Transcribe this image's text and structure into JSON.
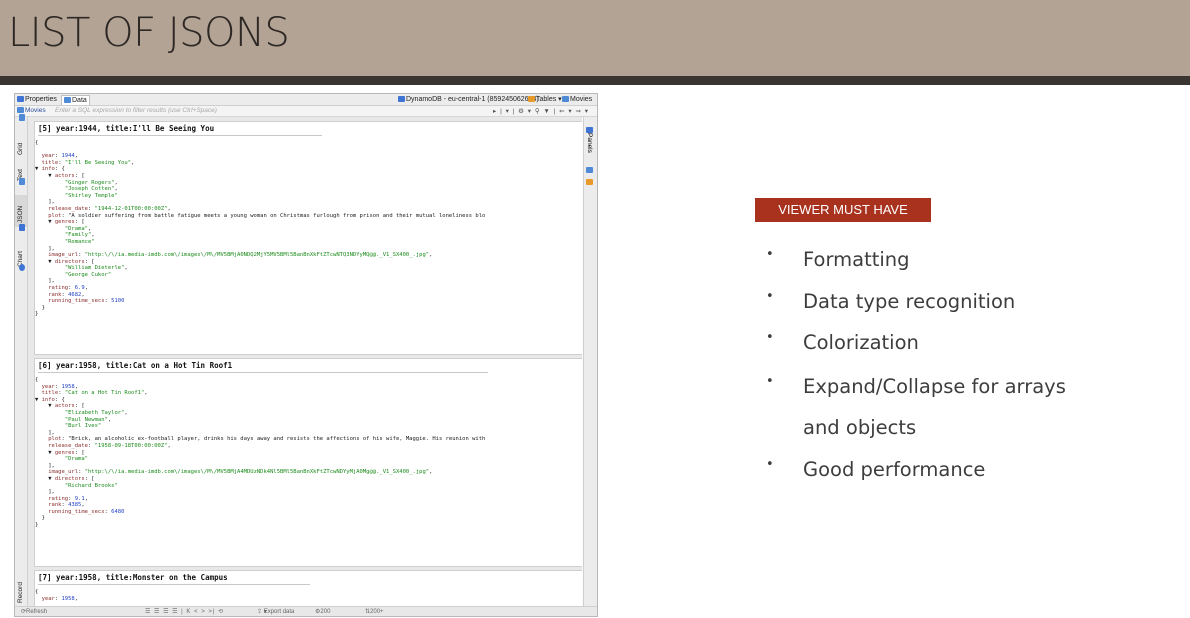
{
  "slide": {
    "title": "LIST OF JSONS",
    "badge": "VIEWER MUST HAVE",
    "bullets": [
      "Formatting",
      "Data type recognition",
      "Colorization",
      "Expand/Collapse for arrays",
      "and objects",
      "Good performance"
    ]
  },
  "app": {
    "tabs": [
      "Properties",
      "Data"
    ],
    "connection": "DynamoDB - eu-central-1 (859245062624)",
    "tables_label": "Tables",
    "table_name": "Movies",
    "filter_label": "Movies",
    "filter_placeholder": "Enter a SQL expression to filter results (use Ctrl+Space)",
    "left_tabs": [
      "Grid",
      "Text",
      "JSON",
      "Chart"
    ],
    "record_tab": "Record",
    "right_panel": "Panels",
    "colors": {
      "key": "#8b2d2d",
      "string": "#1a8a1a",
      "number": "#2241c6",
      "badge": "#a8321e",
      "header_bg": "#b2a395"
    },
    "status": {
      "refresh": "Refresh",
      "export": "Export data",
      "count": "200",
      "total": "200+"
    }
  },
  "records": [
    {
      "header": "[5] year:1944, title:I'll Be Seeing You",
      "lines": [
        "{",
        "",
        "  year: 1944,",
        "  title: \"I'll Be Seeing You\",",
        "▼ info: {",
        "    ▼ actors: [",
        "         \"Ginger Rogers\",",
        "         \"Joseph Cotten\",",
        "         \"Shirley Temple\"",
        "    ],",
        "    release_date: \"1944-12-01T00:00:00Z\",",
        "    plot: \"A soldier suffering from battle fatigue meets a young woman on Christmas furlough from prison and their mutual loneliness blo",
        "    ▼ genres: [",
        "         \"Drama\",",
        "         \"Family\",",
        "         \"Romance\"",
        "    ],",
        "    image_url: \"http:\\/\\/ia.media-imdb.com\\/images\\/M\\/MV5BMjA0NDQ2MjY5MV5BMl5BanBnXkFtZTcwNTQ3NDYyMQ@@._V1_SX400_.jpg\",",
        "    ▼ directors: [",
        "         \"William Dieterle\",",
        "         \"George Cukor\"",
        "    ],",
        "    rating: 6.9,",
        "    rank: 4682,",
        "    running_time_secs: 5100",
        "  }",
        "}"
      ]
    },
    {
      "header": "[6] year:1958, title:Cat on a Hot Tin Roof1",
      "lines": [
        "{",
        "  year: 1958,",
        "  title: \"Cat on a Hot Tin Roof1\",",
        "▼ info: {",
        "    ▼ actors: [",
        "         \"Elizabeth Taylor\",",
        "         \"Paul Newman\",",
        "         \"Burl Ives\"",
        "    ],",
        "    plot: \"Brick, an alcoholic ex-football player, drinks his days away and resists the affections of his wife, Maggie. His reunion with",
        "    release_date: \"1958-09-18T00:00:00Z\",",
        "    ▼ genres: [",
        "         \"Drama\"",
        "    ],",
        "    image_url: \"http:\\/\\/ia.media-imdb.com\\/images\\/M\\/MV5BMjA4MDUzNDk4Nl5BMl5BanBnXkFtZTcwNDYyMjA0Mg@@._V1_SX400_.jpg\",",
        "    ▼ directors: [",
        "         \"Richard Brooks\"",
        "    ],",
        "    rating: 9.1,",
        "    rank: 4385,",
        "    running_time_secs: 6480",
        "  }",
        "}"
      ]
    },
    {
      "header": "[7] year:1958, title:Monster on the Campus",
      "lines": [
        "{",
        "  year: 1958,"
      ]
    }
  ]
}
